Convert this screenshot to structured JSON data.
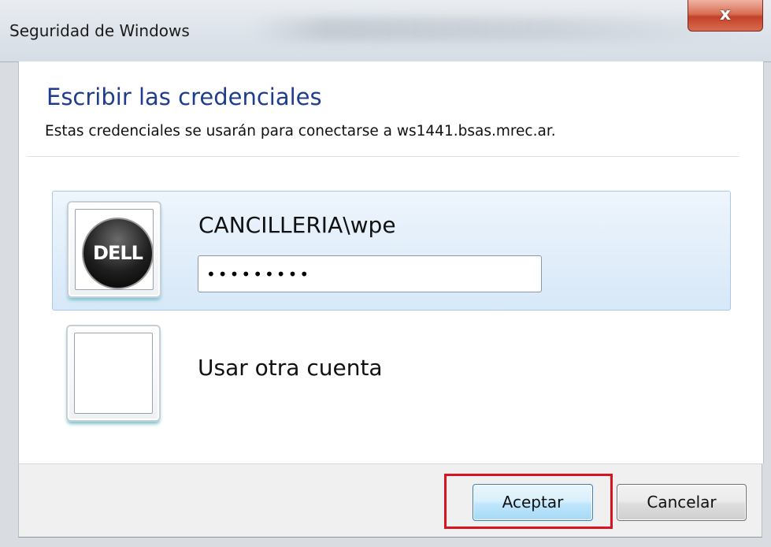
{
  "window": {
    "title": "Seguridad de Windows",
    "close_glyph": "x"
  },
  "dialog": {
    "heading": "Escribir las credenciales",
    "subtitle": "Estas credenciales se usarán para conectarse a ws1441.bsas.mrec.ar."
  },
  "accounts": [
    {
      "username": "CANCILLERIA\\wpe",
      "avatar_logo_text": "DELL",
      "avatar_icon": "dell-logo",
      "password_masked": "•••••••••",
      "selected": true
    },
    {
      "label": "Usar otra cuenta",
      "avatar_icon": "blank-user-tile",
      "selected": false
    }
  ],
  "buttons": {
    "accept": "Aceptar",
    "cancel": "Cancelar"
  },
  "colors": {
    "heading": "#1e3d8f",
    "highlight": "#d8141f",
    "selected_tile": "#d7e8f8"
  }
}
